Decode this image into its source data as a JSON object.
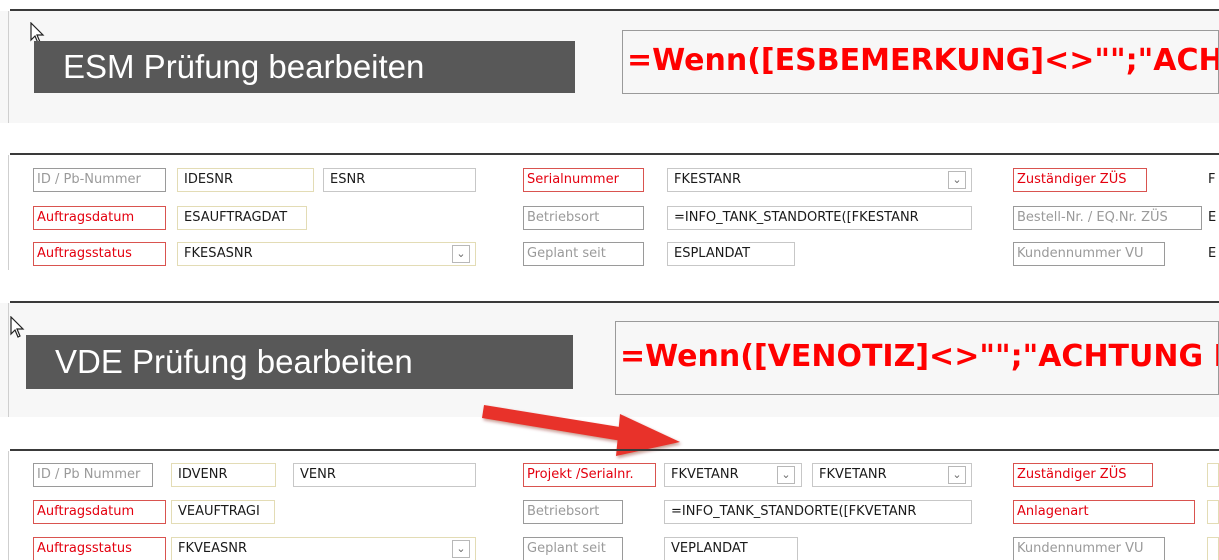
{
  "esm": {
    "title": "ESM Prüfung bearbeiten",
    "formula": "=Wenn([ESBEMERKUNG]<>\"\";\"ACHTUNG",
    "row1": {
      "id_label": "ID / Pb-Nummer",
      "id_value": "IDESNR",
      "nr_value": "ESNR",
      "serial_label": "Serialnummer",
      "serial_value": "FKESTANR",
      "zues_label": "Zuständiger ZÜS",
      "zues_value": "F"
    },
    "row2": {
      "date_label": "Auftragsdatum",
      "date_value": "ESAUFTRAGDAT",
      "site_label": "Betriebsort",
      "site_value": "=INFO_TANK_STANDORTE([FKESTANR",
      "order_label": "Bestell-Nr. / EQ.Nr. ZÜS",
      "order_value": "E"
    },
    "row3": {
      "status_label": "Auftragsstatus",
      "status_value": "FKESASNR",
      "planned_label": "Geplant seit",
      "planned_value": "ESPLANDAT",
      "customer_label": "Kundennummer VU",
      "customer_value": "E"
    }
  },
  "vde": {
    "title": "VDE Prüfung bearbeiten",
    "formula": "=Wenn([VENOTIZ]<>\"\";\"ACHTUNG E",
    "row1": {
      "id_label": "ID / Pb Nummer",
      "id_value": "IDVENR",
      "nr_value": "VENR",
      "project_label": "Projekt /Serialnr.",
      "project_value_1": "FKVETANR",
      "project_value_2": "FKVETANR",
      "zues_label": "Zuständiger ZÜS"
    },
    "row2": {
      "date_label": "Auftragsdatum",
      "date_value": "VEAUFTRAGI",
      "site_label": "Betriebsort",
      "site_value": "=INFO_TANK_STANDORTE([FKVETANR",
      "type_label": "Anlagenart"
    },
    "row3": {
      "status_label": "Auftragsstatus",
      "status_value": "FKVEASNR",
      "planned_label": "Geplant seit",
      "planned_value": "VEPLANDAT",
      "customer_label": "Kundennummer VU"
    }
  },
  "icons": {
    "dropdown": "chevron-down-icon",
    "cursor": "mouse-pointer-icon",
    "annotation": "red-arrow-icon"
  },
  "colors": {
    "title_bg": "#585858",
    "label_red": "#e4000f",
    "formula_red": "#ff0000",
    "arrow": "#e8312a"
  }
}
